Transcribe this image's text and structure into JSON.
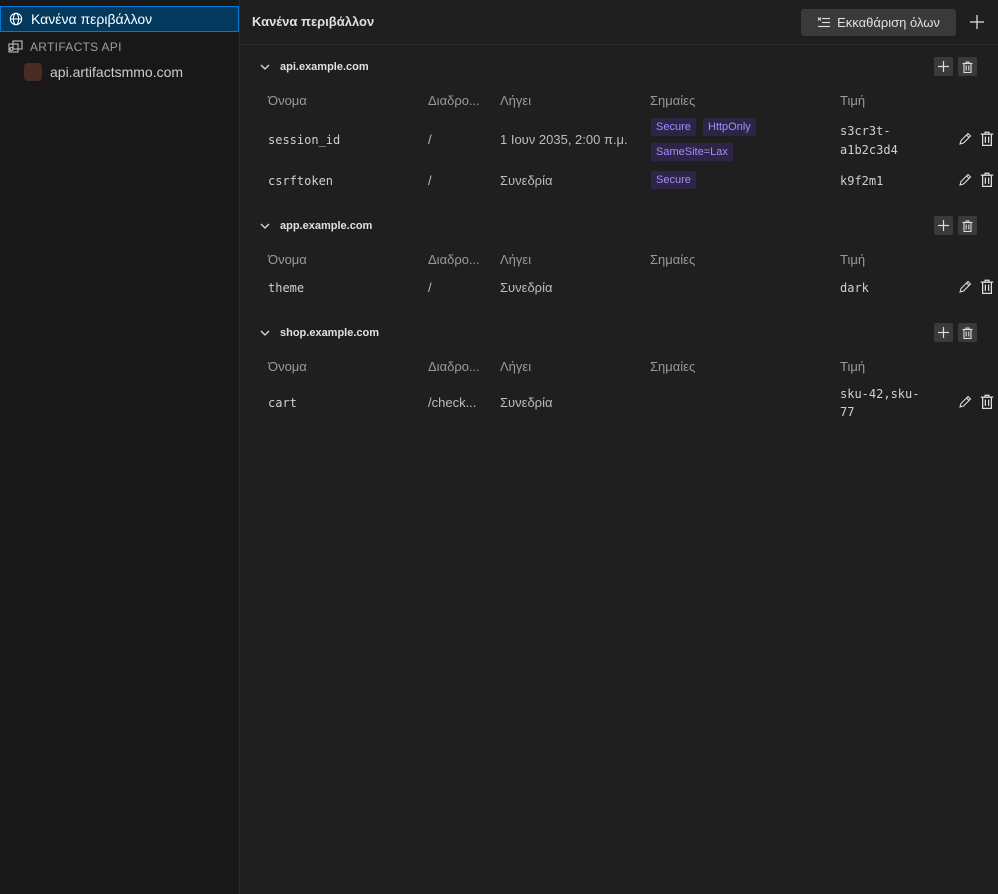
{
  "sidebar": {
    "active_env": "Κανένα περιβάλλον",
    "group": "ARTIFACTS API",
    "group_item": "api.artifactsmmo.com"
  },
  "header": {
    "title": "Κανένα περιβάλλον",
    "clear_all": "Εκκαθάριση όλων"
  },
  "columns": {
    "name": "Όνομα",
    "path": "Διαδρο...",
    "expires": "Λήγει",
    "flags": "Σημαίες",
    "value": "Τιμή"
  },
  "sections": [
    {
      "domain": "api.example.com",
      "rows": [
        {
          "name": "session_id",
          "path": "/",
          "expires": "1 Ιουν 2035, 2:00 π.μ.",
          "flags": [
            "Secure",
            "HttpOnly",
            "SameSite=Lax"
          ],
          "value_line1": "s3cr3t-",
          "value_line2": "a1b2c3d4"
        },
        {
          "name": "csrftoken",
          "path": "/",
          "expires": "Συνεδρία",
          "flags": [
            "Secure"
          ],
          "value_line1": "k9f2m1",
          "value_line2": ""
        }
      ]
    },
    {
      "domain": "app.example.com",
      "rows": [
        {
          "name": "theme",
          "path": "/",
          "expires": "Συνεδρία",
          "flags": [],
          "value_line1": "dark",
          "value_line2": ""
        }
      ]
    },
    {
      "domain": "shop.example.com",
      "rows": [
        {
          "name": "cart",
          "path": "/check...",
          "expires": "Συνεδρία",
          "flags": [],
          "value_line1": "sku-42,sku-",
          "value_line2": "77"
        }
      ]
    }
  ]
}
